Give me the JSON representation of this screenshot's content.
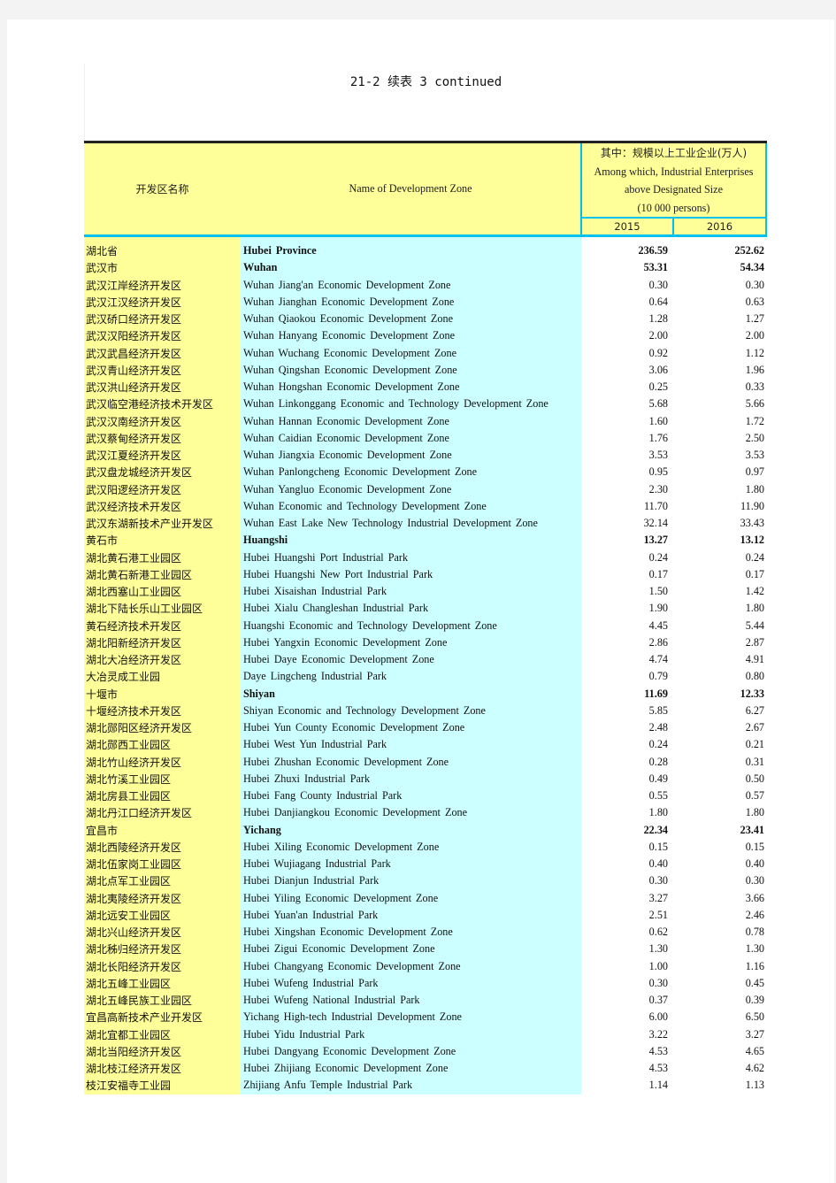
{
  "title": "21-2  续表 3 continued",
  "header": {
    "col_zh": "开发区名称",
    "col_en": "Name of Development Zone",
    "group_lines": [
      "其中：规模以上工业企业(万人)",
      "Among which, Industrial Enterprises",
      "above Designated Size",
      "(10 000 persons)"
    ],
    "years": [
      "2015",
      "2016"
    ]
  },
  "rows": [
    {
      "zh": "湖北省",
      "en": "Hubei  Province",
      "v2015": "236.59",
      "v2016": "252.62",
      "bold": true
    },
    {
      "zh": "武汉市",
      "en": "Wuhan",
      "v2015": "53.31",
      "v2016": "54.34",
      "bold": true
    },
    {
      "zh": "武汉江岸经济开发区",
      "en": "Wuhan Jiang'an Economic Development Zone",
      "v2015": "0.30",
      "v2016": "0.30"
    },
    {
      "zh": "武汉江汉经济开发区",
      "en": "Wuhan Jianghan Economic Development Zone",
      "v2015": "0.64",
      "v2016": "0.63"
    },
    {
      "zh": "武汉硚口经济开发区",
      "en": "Wuhan Qiaokou Economic Development Zone",
      "v2015": "1.28",
      "v2016": "1.27"
    },
    {
      "zh": "武汉汉阳经济开发区",
      "en": "Wuhan Hanyang Economic Development Zone",
      "v2015": "2.00",
      "v2016": "2.00"
    },
    {
      "zh": "武汉武昌经济开发区",
      "en": "Wuhan Wuchang Economic Development Zone",
      "v2015": "0.92",
      "v2016": "1.12"
    },
    {
      "zh": "武汉青山经济开发区",
      "en": "Wuhan Qingshan Economic Development Zone",
      "v2015": "3.06",
      "v2016": "1.96"
    },
    {
      "zh": "武汉洪山经济开发区",
      "en": "Wuhan Hongshan Economic Development Zone",
      "v2015": "0.25",
      "v2016": "0.33"
    },
    {
      "zh": "武汉临空港经济技术开发区",
      "en": "Wuhan Linkonggang Economic and Technology Development Zone",
      "v2015": "5.68",
      "v2016": "5.66"
    },
    {
      "zh": "武汉汉南经济开发区",
      "en": "Wuhan Hannan Economic Development Zone",
      "v2015": "1.60",
      "v2016": "1.72"
    },
    {
      "zh": "武汉蔡甸经济开发区",
      "en": "Wuhan Caidian Economic Development Zone",
      "v2015": "1.76",
      "v2016": "2.50"
    },
    {
      "zh": "武汉江夏经济开发区",
      "en": "Wuhan Jiangxia Economic Development Zone",
      "v2015": "3.53",
      "v2016": "3.53"
    },
    {
      "zh": "武汉盘龙城经济开发区",
      "en": "Wuhan Panlongcheng Economic Development Zone",
      "v2015": "0.95",
      "v2016": "0.97"
    },
    {
      "zh": "武汉阳逻经济开发区",
      "en": "Wuhan Yangluo Economic Development Zone",
      "v2015": "2.30",
      "v2016": "1.80"
    },
    {
      "zh": "武汉经济技术开发区",
      "en": "Wuhan Economic and Technology Development Zone",
      "v2015": "11.70",
      "v2016": "11.90"
    },
    {
      "zh": "武汉东湖新技术产业开发区",
      "en": "Wuhan East Lake New Technology Industrial Development Zone",
      "v2015": "32.14",
      "v2016": "33.43"
    },
    {
      "zh": "黄石市",
      "en": "Huangshi",
      "v2015": "13.27",
      "v2016": "13.12",
      "bold": true
    },
    {
      "zh": "湖北黄石港工业园区",
      "en": "Hubei Huangshi Port Industrial Park",
      "v2015": "0.24",
      "v2016": "0.24"
    },
    {
      "zh": "湖北黄石新港工业园区",
      "en": "Hubei Huangshi New Port Industrial Park",
      "v2015": "0.17",
      "v2016": "0.17"
    },
    {
      "zh": "湖北西塞山工业园区",
      "en": "Hubei Xisaishan Industrial Park",
      "v2015": "1.50",
      "v2016": "1.42"
    },
    {
      "zh": "湖北下陆长乐山工业园区",
      "en": "Hubei Xialu Changleshan Industrial Park",
      "v2015": "1.90",
      "v2016": "1.80"
    },
    {
      "zh": "黄石经济技术开发区",
      "en": "Huangshi Economic and Technology Development Zone",
      "v2015": "4.45",
      "v2016": "5.44"
    },
    {
      "zh": "湖北阳新经济开发区",
      "en": "Hubei Yangxin Economic Development Zone",
      "v2015": "2.86",
      "v2016": "2.87"
    },
    {
      "zh": "湖北大冶经济开发区",
      "en": "Hubei Daye Economic Development Zone",
      "v2015": "4.74",
      "v2016": "4.91"
    },
    {
      "zh": "大冶灵成工业园",
      "en": "Daye Lingcheng Industrial Park",
      "v2015": "0.79",
      "v2016": "0.80"
    },
    {
      "zh": "十堰市",
      "en": "Shiyan",
      "v2015": "11.69",
      "v2016": "12.33",
      "bold": true
    },
    {
      "zh": "十堰经济技术开发区",
      "en": "Shiyan Economic and Technology Development Zone",
      "v2015": "5.85",
      "v2016": "6.27"
    },
    {
      "zh": "湖北郧阳区经济开发区",
      "en": "Hubei Yun County Economic Development Zone",
      "v2015": "2.48",
      "v2016": "2.67"
    },
    {
      "zh": "湖北郧西工业园区",
      "en": "Hubei West Yun Industrial Park",
      "v2015": "0.24",
      "v2016": "0.21"
    },
    {
      "zh": "湖北竹山经济开发区",
      "en": "Hubei Zhushan Economic Development Zone",
      "v2015": "0.28",
      "v2016": "0.31"
    },
    {
      "zh": "湖北竹溪工业园区",
      "en": "Hubei Zhuxi Industrial Park",
      "v2015": "0.49",
      "v2016": "0.50"
    },
    {
      "zh": "湖北房县工业园区",
      "en": "Hubei Fang County Industrial Park",
      "v2015": "0.55",
      "v2016": "0.57"
    },
    {
      "zh": "湖北丹江口经济开发区",
      "en": "Hubei Danjiangkou Economic Development Zone",
      "v2015": "1.80",
      "v2016": "1.80"
    },
    {
      "zh": "宜昌市",
      "en": "Yichang",
      "v2015": "22.34",
      "v2016": "23.41",
      "bold": true
    },
    {
      "zh": "湖北西陵经济开发区",
      "en": "Hubei Xiling Economic Development Zone",
      "v2015": "0.15",
      "v2016": "0.15"
    },
    {
      "zh": "湖北伍家岗工业园区",
      "en": "Hubei Wujiagang Industrial Park",
      "v2015": "0.40",
      "v2016": "0.40"
    },
    {
      "zh": "湖北点军工业园区",
      "en": "Hubei Dianjun Industrial Park",
      "v2015": "0.30",
      "v2016": "0.30"
    },
    {
      "zh": "湖北夷陵经济开发区",
      "en": "Hubei Yiling Economic Development Zone",
      "v2015": "3.27",
      "v2016": "3.66"
    },
    {
      "zh": "湖北远安工业园区",
      "en": "Hubei Yuan'an Industrial Park",
      "v2015": "2.51",
      "v2016": "2.46"
    },
    {
      "zh": "湖北兴山经济开发区",
      "en": "Hubei Xingshan Economic Development Zone",
      "v2015": "0.62",
      "v2016": "0.78"
    },
    {
      "zh": "湖北秭归经济开发区",
      "en": "Hubei Zigui Economic Development Zone",
      "v2015": "1.30",
      "v2016": "1.30"
    },
    {
      "zh": "湖北长阳经济开发区",
      "en": "Hubei Changyang Economic Development Zone",
      "v2015": "1.00",
      "v2016": "1.16"
    },
    {
      "zh": "湖北五峰工业园区",
      "en": "Hubei Wufeng Industrial Park",
      "v2015": "0.30",
      "v2016": "0.45"
    },
    {
      "zh": "湖北五峰民族工业园区",
      "en": "Hubei Wufeng National Industrial Park",
      "v2015": "0.37",
      "v2016": "0.39"
    },
    {
      "zh": "宜昌高新技术产业开发区",
      "en": "Yichang High-tech Industrial Development Zone",
      "v2015": "6.00",
      "v2016": "6.50"
    },
    {
      "zh": "湖北宜都工业园区",
      "en": "Hubei Yidu Industrial Park",
      "v2015": "3.22",
      "v2016": "3.27"
    },
    {
      "zh": "湖北当阳经济开发区",
      "en": "Hubei Dangyang Economic Development Zone",
      "v2015": "4.53",
      "v2016": "4.65"
    },
    {
      "zh": "湖北枝江经济开发区",
      "en": "Hubei Zhijiang Economic Development Zone",
      "v2015": "4.53",
      "v2016": "4.62"
    },
    {
      "zh": "枝江安福寺工业园",
      "en": "Zhijiang Anfu Temple Industrial Park",
      "v2015": "1.14",
      "v2016": "1.13"
    }
  ]
}
